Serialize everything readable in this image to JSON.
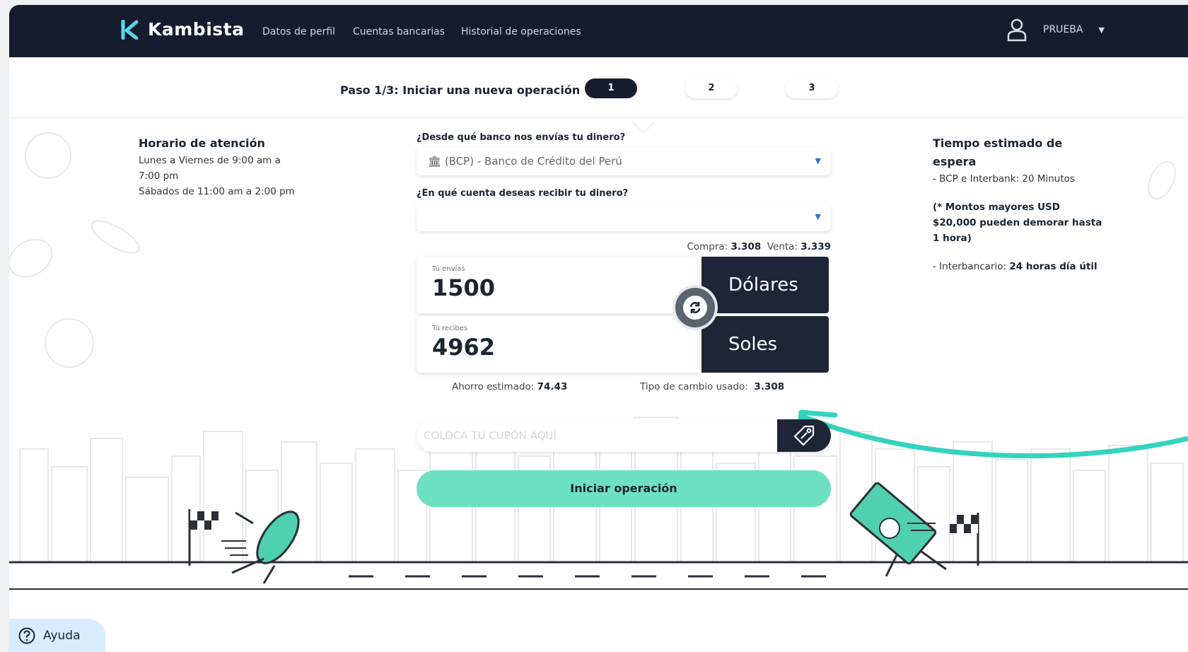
{
  "navbar": {
    "brand": "Kambista",
    "links": [
      "Datos de perfil",
      "Cuentas bancarias",
      "Historial de operaciones"
    ],
    "user": "PRUEBA"
  },
  "steps": {
    "title": "Paso 1/3: Iniciar una nueva operación",
    "items": [
      "1",
      "2",
      "3"
    ],
    "active": "1"
  },
  "left_info": {
    "title": "Horario de atención",
    "lines": [
      "Lunes a Viernes de 9:00 am a 7:00 pm",
      "Sábados de 11:00 am a 2:00 pm"
    ]
  },
  "right_info": {
    "title": "Tiempo estimado de espera",
    "line1": "- BCP e Interbank: 20 Minutos",
    "note": "(* Montos mayores USD $20,000 pueden demorar hasta 1 hora)",
    "line2_prefix": "- Interbancario:",
    "line2_bold": "24 horas día útil"
  },
  "form": {
    "from_bank_label": "¿Desde qué banco nos envías tu dinero?",
    "from_bank_value": "(BCP) - Banco de Crédito del Perú",
    "to_account_label": "¿En qué cuenta deseas recibir tu dinero?",
    "to_account_value": "",
    "rates": {
      "buy_label": "Compra:",
      "buy": "3.308",
      "sell_label": "Venta:",
      "sell": "3.339"
    },
    "send": {
      "caption": "Tú envías",
      "amount": "1500",
      "currency": "Dólares"
    },
    "receive": {
      "caption": "Tú recibes",
      "amount": "4962",
      "currency": "Soles"
    },
    "savings_label": "Ahorro estimado:",
    "savings": "74.43",
    "rate_used_label": "Tipo de cambio usado:",
    "rate_used": "3.308",
    "coupon_placeholder": "COLOCA TU CUPÓN AQUÍ",
    "submit": "Iniciar operación"
  },
  "help": {
    "label": "Ayuda"
  },
  "colors": {
    "navy": "#141c2e",
    "accent": "#6ee0c2",
    "arrow": "#34d3bf",
    "link_blue": "#2b6fd6"
  },
  "icons": [
    "kambista-logo-icon",
    "user-icon",
    "caret-down-icon",
    "bank-icon",
    "swap-icon",
    "tag-icon",
    "help-icon"
  ]
}
